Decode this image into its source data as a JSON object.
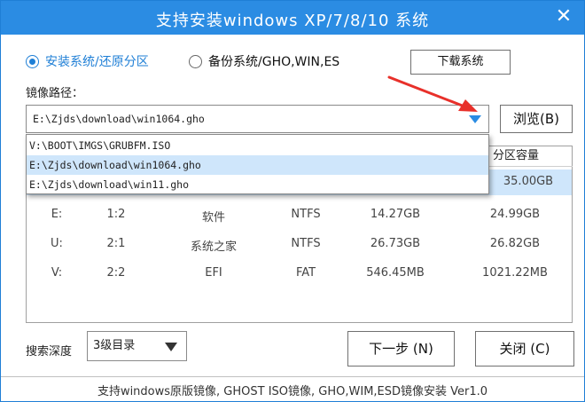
{
  "window": {
    "title": "支持安装windows XP/7/8/10 系统",
    "close_glyph": "✕"
  },
  "mode": {
    "install_restore_label": "安装系统/还原分区",
    "backup_label": "备份系统/GHO,WIN,ES",
    "selected": "install_restore"
  },
  "download_button_label": "下载系统",
  "image_path": {
    "label": "镜像路径：",
    "value": "E:\\Zjds\\download\\win1064.gho",
    "browse_label": "浏览(B)",
    "options": [
      "V:\\BOOT\\IMGS\\GRUBFM.ISO",
      "E:\\Zjds\\download\\win1064.gho",
      "E:\\Zjds\\download\\win11.gho"
    ],
    "highlighted_option": 1
  },
  "partition_table": {
    "capacity_header": "分区容量",
    "selected_row_capacity": "35.00GB",
    "rows": [
      {
        "drive": "E:",
        "index": "1:2",
        "label": "软件",
        "fs": "NTFS",
        "free": "14.27GB",
        "size": "24.99GB"
      },
      {
        "drive": "U:",
        "index": "2:1",
        "label": "系统之家",
        "fs": "NTFS",
        "free": "26.73GB",
        "size": "26.82GB"
      },
      {
        "drive": "V:",
        "index": "2:2",
        "label": "EFI",
        "fs": "FAT",
        "free": "546.45MB",
        "size": "1021.22MB"
      }
    ]
  },
  "search_depth": {
    "label": "搜索深度",
    "value": "3级目录"
  },
  "buttons": {
    "next": "下一步 (N)",
    "close": "关闭 (C)"
  },
  "footer": "支持windows原版镜像, GHOST ISO镜像, GHO,WIM,ESD镜像安装 Ver1.0",
  "colors": {
    "titlebar": "#2b8ce3",
    "accent": "#1f7fd6",
    "selection": "#cfe6fb",
    "annotation_arrow": "#e8302a"
  }
}
